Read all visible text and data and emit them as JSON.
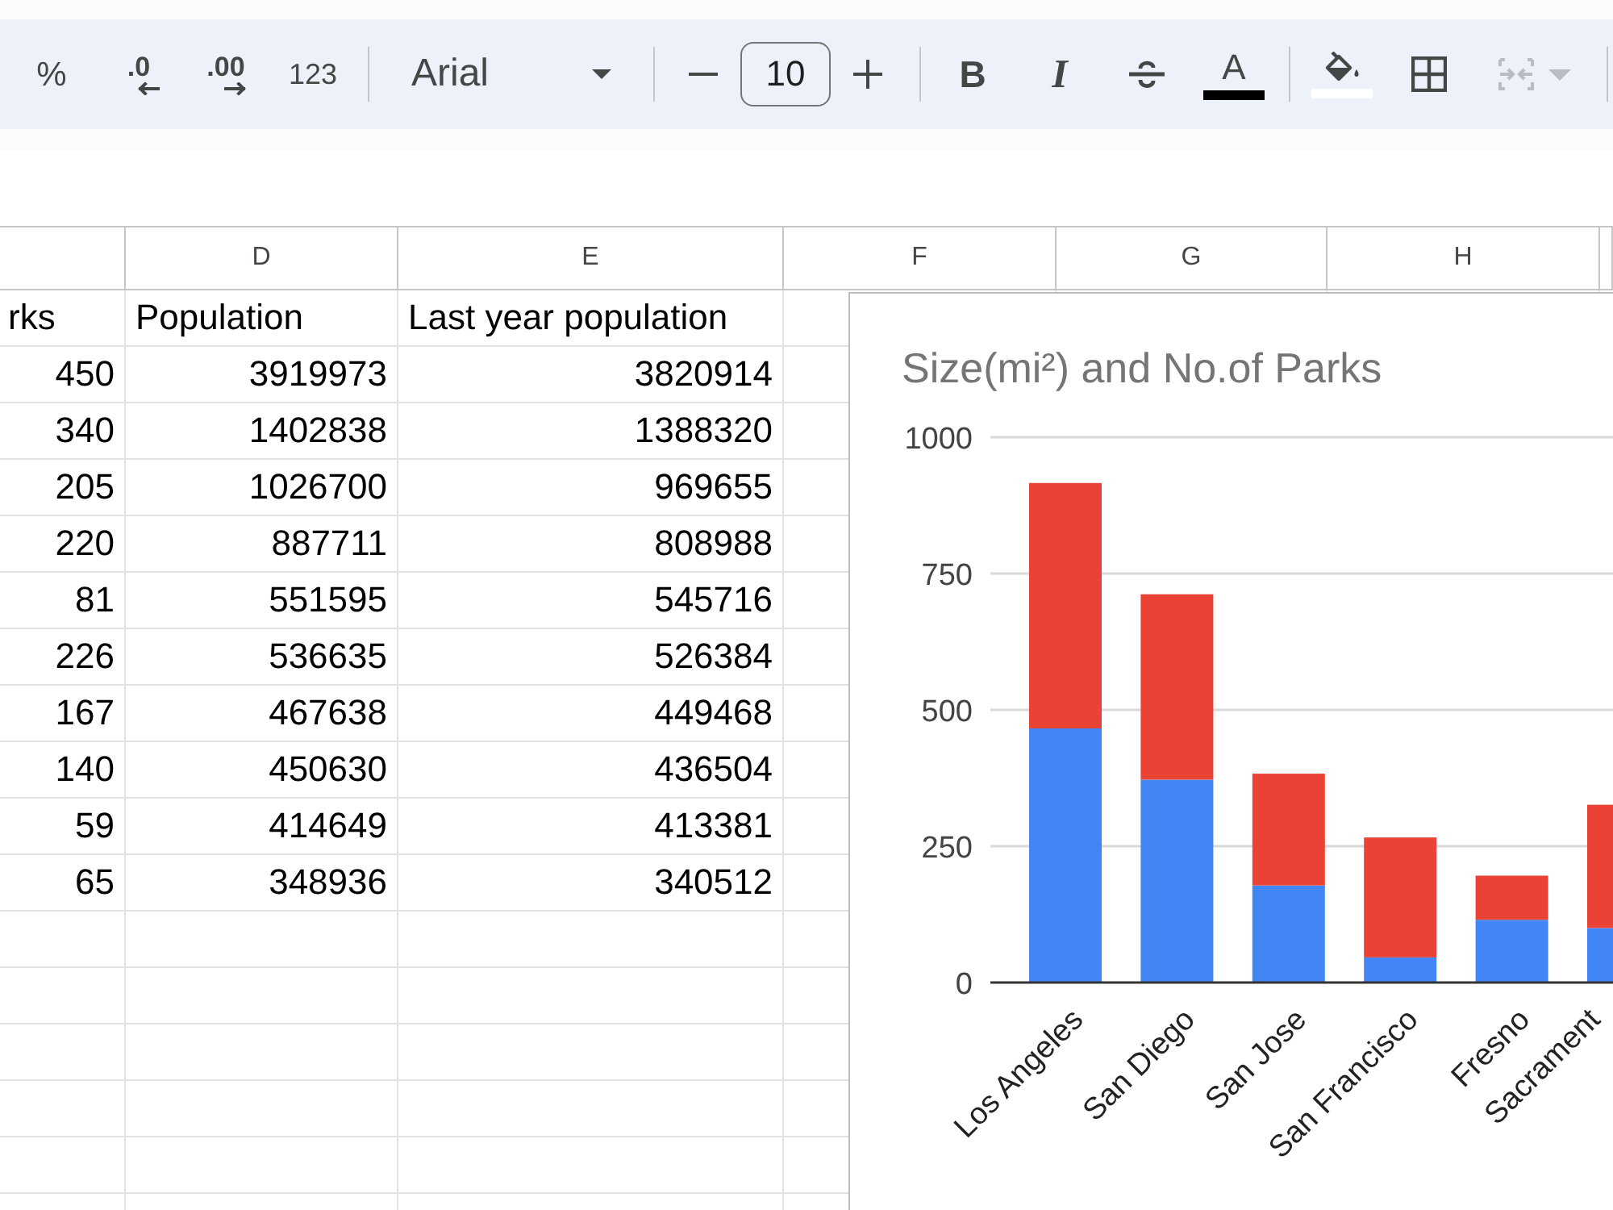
{
  "toolbar": {
    "groups": [
      [
        {
          "kind": "percent",
          "label": "%",
          "disabled": false
        },
        {
          "kind": "decimal_less",
          "label": ".0",
          "disabled": false
        },
        {
          "kind": "decimal_more",
          "label": ".00",
          "disabled": false
        },
        {
          "kind": "number_format",
          "label": "123",
          "disabled": false
        }
      ],
      [
        {
          "kind": "font",
          "value": "Arial",
          "disabled": false
        }
      ],
      [
        {
          "kind": "size_down",
          "disabled": false
        },
        {
          "kind": "size",
          "value": "10",
          "disabled": false
        },
        {
          "kind": "size_up",
          "disabled": false
        }
      ],
      [
        {
          "kind": "bold",
          "label": "B",
          "disabled": false
        },
        {
          "kind": "italic",
          "label": "I",
          "disabled": false
        },
        {
          "kind": "strikethrough",
          "disabled": false
        },
        {
          "kind": "text_color",
          "label": "A",
          "color": "#000000",
          "disabled": false
        }
      ],
      [
        {
          "kind": "fill_color",
          "color": "#ffffff",
          "disabled": false
        },
        {
          "kind": "borders",
          "disabled": false
        },
        {
          "kind": "merge",
          "disabled": true
        }
      ]
    ]
  },
  "sheet": {
    "column_letters": [
      "D",
      "E",
      "F",
      "G",
      "H"
    ],
    "header": [
      "rks",
      "Population",
      "Last year population"
    ],
    "rows": [
      [
        "450",
        "3919973",
        "3820914"
      ],
      [
        "340",
        "1402838",
        "1388320"
      ],
      [
        "205",
        "1026700",
        "969655"
      ],
      [
        "220",
        "887711",
        "808988"
      ],
      [
        "81",
        "551595",
        "545716"
      ],
      [
        "226",
        "536635",
        "526384"
      ],
      [
        "167",
        "467638",
        "449468"
      ],
      [
        "140",
        "450630",
        "436504"
      ],
      [
        "59",
        "414649",
        "413381"
      ],
      [
        "65",
        "348936",
        "340512"
      ]
    ],
    "chart": {
      "chart_data": {
        "type": "bar",
        "title": "Size(mi²) and No.of Parks",
        "categories": [
          "Los Angeles",
          "San Diego",
          "San Jose",
          "San Francisco",
          "Fresno",
          "Sacrament"
        ],
        "stacked": true,
        "series": [
          {
            "color": "#4285f4",
            "values": [
              466,
              372,
              178,
              46,
              115,
              100
            ]
          },
          {
            "color": "#ea4335",
            "values": [
              450,
              340,
              205,
              220,
              81,
              226
            ]
          }
        ],
        "ylim": [
          0,
          1000
        ],
        "yticks": [
          0,
          250,
          500,
          750,
          1000
        ],
        "grid": true
      }
    }
  }
}
